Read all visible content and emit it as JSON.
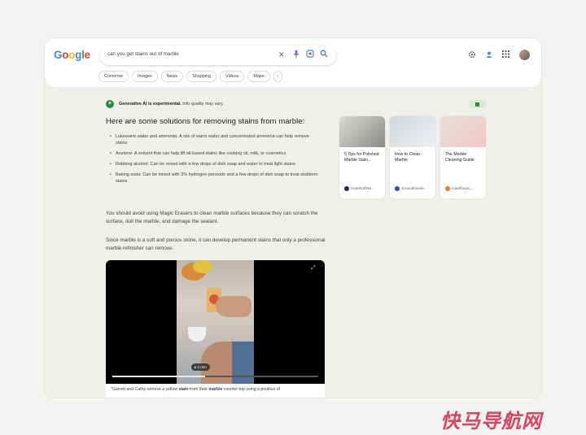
{
  "header": {
    "logo_letters": [
      {
        "ch": "G",
        "color": "#4285f4"
      },
      {
        "ch": "o",
        "color": "#ea4335"
      },
      {
        "ch": "o",
        "color": "#fbbc05"
      },
      {
        "ch": "g",
        "color": "#4285f4"
      },
      {
        "ch": "l",
        "color": "#34a853"
      },
      {
        "ch": "e",
        "color": "#ea4335"
      }
    ],
    "search_query": "can you get stains out of marble",
    "icons": [
      "close-icon",
      "mic-icon",
      "lens-icon",
      "search-icon",
      "settings-icon",
      "labs-icon",
      "apps-icon",
      "avatar"
    ]
  },
  "chips": [
    "Converse",
    "Images",
    "News",
    "Shopping",
    "Videos",
    "Maps",
    "›"
  ],
  "ai": {
    "badge_glyph": "✦",
    "notice_bold": "Generative AI is experimental.",
    "notice_rest": " Info quality may vary.",
    "heading": "Here are some solutions for removing stains from marble:",
    "bullets": [
      "Lukewarm water and ammonia: A mix of warm water and concentrated ammonia can help remove stains",
      "Acetone: A solvent that can help lift oil-based stains like cooking oil, milk, or cosmetics",
      "Rubbing alcohol: Can be mixed with a few drops of dish soap and water to treat light stains",
      "Baking soda: Can be mixed with 3% hydrogen peroxide and a few drops of dish soap to treat stubborn stains"
    ],
    "paragraph_1": "You should avoid using Magic Erasers to clean marble surfaces because they can scratch the surface, dull the marble, and damage the sealant.",
    "paragraph_2": "Since marble is a soft and porous stone, it can develop permanent stains that only a professional marble refinisher can remove."
  },
  "video": {
    "duration_label": "▸ 1 min",
    "progress": 0.45,
    "caption_parts": [
      "\"Garrett and Cathy remove a yellow ",
      "stain",
      " from their ",
      "marble",
      " counter top using a poultice of"
    ]
  },
  "cards": [
    {
      "title": "5 Tips for Polished Marble Stain...",
      "source": "HowStuffWo...",
      "fav_color": "#1f2a44",
      "img_colors": [
        "#d9dbd8",
        "#8d8a86"
      ]
    },
    {
      "title": "How to Clean Marble",
      "source": "Groundhouse...",
      "fav_color": "#3a4ab3",
      "img_colors": [
        "#cfd6da",
        "#eef1f2"
      ]
    },
    {
      "title": "The Marble Cleaning Guide",
      "source": "maidforyou...",
      "fav_color": "#e8753a",
      "img_colors": [
        "#e5e0da",
        "#f3c6c4"
      ]
    }
  ],
  "watermark": "快马导航网"
}
